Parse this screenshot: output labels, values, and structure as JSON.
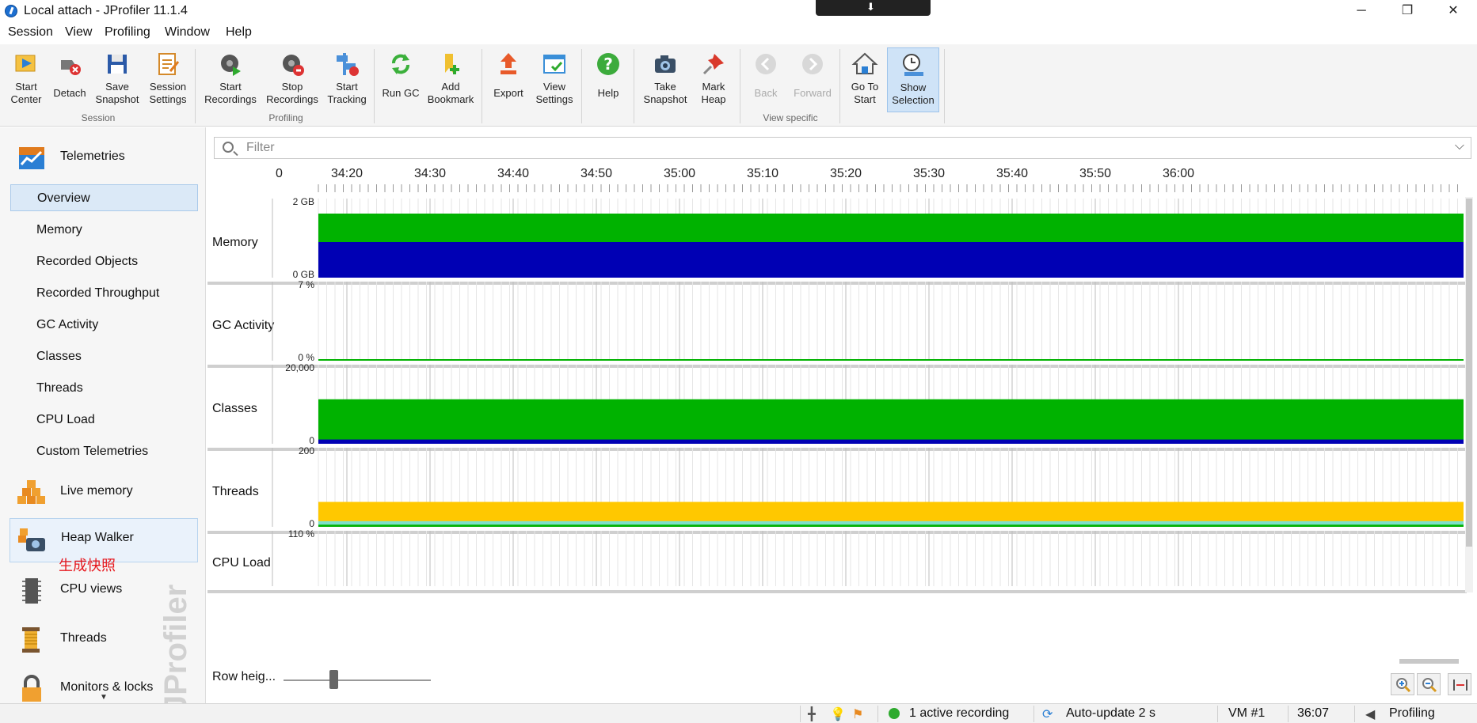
{
  "window": {
    "title": "Local attach - JProfiler 11.1.4",
    "minimize": "─",
    "restore": "❐",
    "close": "✕"
  },
  "menus": [
    "Session",
    "View",
    "Profiling",
    "Window",
    "Help"
  ],
  "toolbar": {
    "buttons": [
      {
        "id": "start-center",
        "label": "Start\nCenter",
        "icon": "start-center-icon"
      },
      {
        "id": "detach",
        "label": "Detach",
        "icon": "detach-icon"
      },
      {
        "id": "save-snapshot",
        "label": "Save\nSnapshot",
        "icon": "save-icon"
      },
      {
        "id": "session-settings",
        "label": "Session\nSettings",
        "icon": "session-settings-icon"
      },
      {
        "id": "start-recordings",
        "label": "Start\nRecordings",
        "icon": "start-recordings-icon"
      },
      {
        "id": "stop-recordings",
        "label": "Stop\nRecordings",
        "icon": "stop-recordings-icon"
      },
      {
        "id": "start-tracking",
        "label": "Start\nTracking",
        "icon": "start-tracking-icon"
      },
      {
        "id": "run-gc",
        "label": "Run GC",
        "icon": "run-gc-icon"
      },
      {
        "id": "add-bookmark",
        "label": "Add\nBookmark",
        "icon": "add-bookmark-icon"
      },
      {
        "id": "export",
        "label": "Export",
        "icon": "export-icon"
      },
      {
        "id": "view-settings",
        "label": "View\nSettings",
        "icon": "view-settings-icon"
      },
      {
        "id": "help",
        "label": "Help",
        "icon": "help-icon"
      },
      {
        "id": "take-snapshot",
        "label": "Take\nSnapshot",
        "icon": "camera-icon"
      },
      {
        "id": "mark-heap",
        "label": "Mark\nHeap",
        "icon": "pin-icon"
      },
      {
        "id": "back",
        "label": "Back",
        "icon": "back-icon"
      },
      {
        "id": "forward",
        "label": "Forward",
        "icon": "forward-icon"
      },
      {
        "id": "go-to-start",
        "label": "Go To\nStart",
        "icon": "home-icon"
      },
      {
        "id": "show-selection",
        "label": "Show\nSelection",
        "icon": "clock-icon"
      }
    ],
    "groups": [
      "Session",
      "Profiling",
      "View specific"
    ]
  },
  "sidebar": {
    "sections": [
      {
        "label": "Telemetries",
        "icon": "telemetries-icon"
      },
      {
        "label": "Live memory",
        "icon": "live-memory-icon"
      },
      {
        "label": "Heap Walker",
        "icon": "heap-walker-icon"
      },
      {
        "label": "CPU views",
        "icon": "cpu-views-icon"
      },
      {
        "label": "Threads",
        "icon": "threads-icon"
      },
      {
        "label": "Monitors & locks",
        "icon": "monitors-locks-icon"
      }
    ],
    "items": [
      "Overview",
      "Memory",
      "Recorded Objects",
      "Recorded Throughput",
      "GC Activity",
      "Classes",
      "Threads",
      "CPU Load",
      "Custom Telemetries"
    ],
    "annotation": "生成快照",
    "watermark": "JProfiler"
  },
  "filter": {
    "placeholder": "Filter"
  },
  "timeline": {
    "ticks": [
      "0",
      "34:20",
      "34:30",
      "34:40",
      "34:50",
      "35:00",
      "35:10",
      "35:20",
      "35:30",
      "35:40",
      "35:50",
      "36:00"
    ]
  },
  "colors": {
    "green": "#00b200",
    "blue": "#0000b4",
    "yellow": "#ffc800",
    "teal": "#7fe0c8",
    "annotation": "#e6161c"
  },
  "chart_data": [
    {
      "type": "area",
      "title": "Memory",
      "ytop": "2 GB",
      "ybottom": "0 GB",
      "series": [
        {
          "color": "green",
          "values": [
            1.8
          ]
        },
        {
          "color": "blue",
          "values": [
            1.0
          ]
        }
      ]
    },
    {
      "type": "line",
      "title": "GC Activity",
      "ytop": "7 %",
      "ybottom": "0 %",
      "series": [
        {
          "color": "green",
          "values": [
            0
          ]
        }
      ]
    },
    {
      "type": "area",
      "title": "Classes",
      "ytop": "20,000",
      "ybottom": "0",
      "series": [
        {
          "color": "green",
          "values": [
            12500
          ]
        },
        {
          "color": "blue",
          "values": [
            1200
          ]
        }
      ]
    },
    {
      "type": "area",
      "title": "Threads",
      "ytop": "200",
      "ybottom": "0",
      "series": [
        {
          "color": "yellow",
          "values": [
            70
          ]
        },
        {
          "color": "teal",
          "values": [
            16
          ]
        },
        {
          "color": "green",
          "values": [
            6
          ]
        }
      ]
    },
    {
      "type": "area",
      "title": "CPU Load",
      "ytop": "110 %",
      "ybottom": "",
      "series": []
    }
  ],
  "controls": {
    "row_height": "Row heig..."
  },
  "status": {
    "recording": "1 active recording",
    "autoupdate": "Auto-update 2 s",
    "vm": "VM #1",
    "time": "36:07",
    "mode": "Profiling"
  }
}
